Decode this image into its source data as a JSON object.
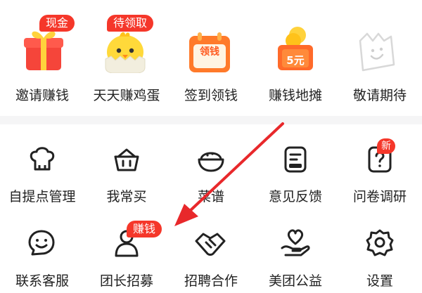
{
  "top_row": [
    {
      "label": "邀请赚钱",
      "badge": "现金",
      "icon": "gift-box-icon"
    },
    {
      "label": "天天赚鸡蛋",
      "badge": "待领取",
      "icon": "chick-egg-icon"
    },
    {
      "label": "签到领钱",
      "badge": "",
      "icon": "calendar-icon",
      "icon_text": "领钱"
    },
    {
      "label": "赚钱地摊",
      "badge": "",
      "icon": "money-stall-icon",
      "icon_text": "5元"
    },
    {
      "label": "敬请期待",
      "badge": "",
      "icon": "smiley-bag-icon"
    }
  ],
  "tools_row1": [
    {
      "label": "自提点管理",
      "badge": "",
      "icon": "chef-hat-icon"
    },
    {
      "label": "我常买",
      "badge": "",
      "icon": "basket-icon"
    },
    {
      "label": "菜谱",
      "badge": "",
      "icon": "rice-bowl-icon"
    },
    {
      "label": "意见反馈",
      "badge": "",
      "icon": "feedback-icon"
    },
    {
      "label": "问卷调研",
      "badge": "新",
      "icon": "question-icon"
    }
  ],
  "tools_row2": [
    {
      "label": "联系客服",
      "badge": "",
      "icon": "chat-smile-icon"
    },
    {
      "label": "团长招募",
      "badge": "赚钱",
      "icon": "person-icon"
    },
    {
      "label": "招聘合作",
      "badge": "",
      "icon": "handshake-icon"
    },
    {
      "label": "美团公益",
      "badge": "",
      "icon": "heart-hand-icon"
    },
    {
      "label": "设置",
      "badge": "",
      "icon": "settings-icon"
    }
  ],
  "colors": {
    "accent_red": "#f5372a",
    "arrow_red": "#e8282b",
    "text": "#222222"
  }
}
